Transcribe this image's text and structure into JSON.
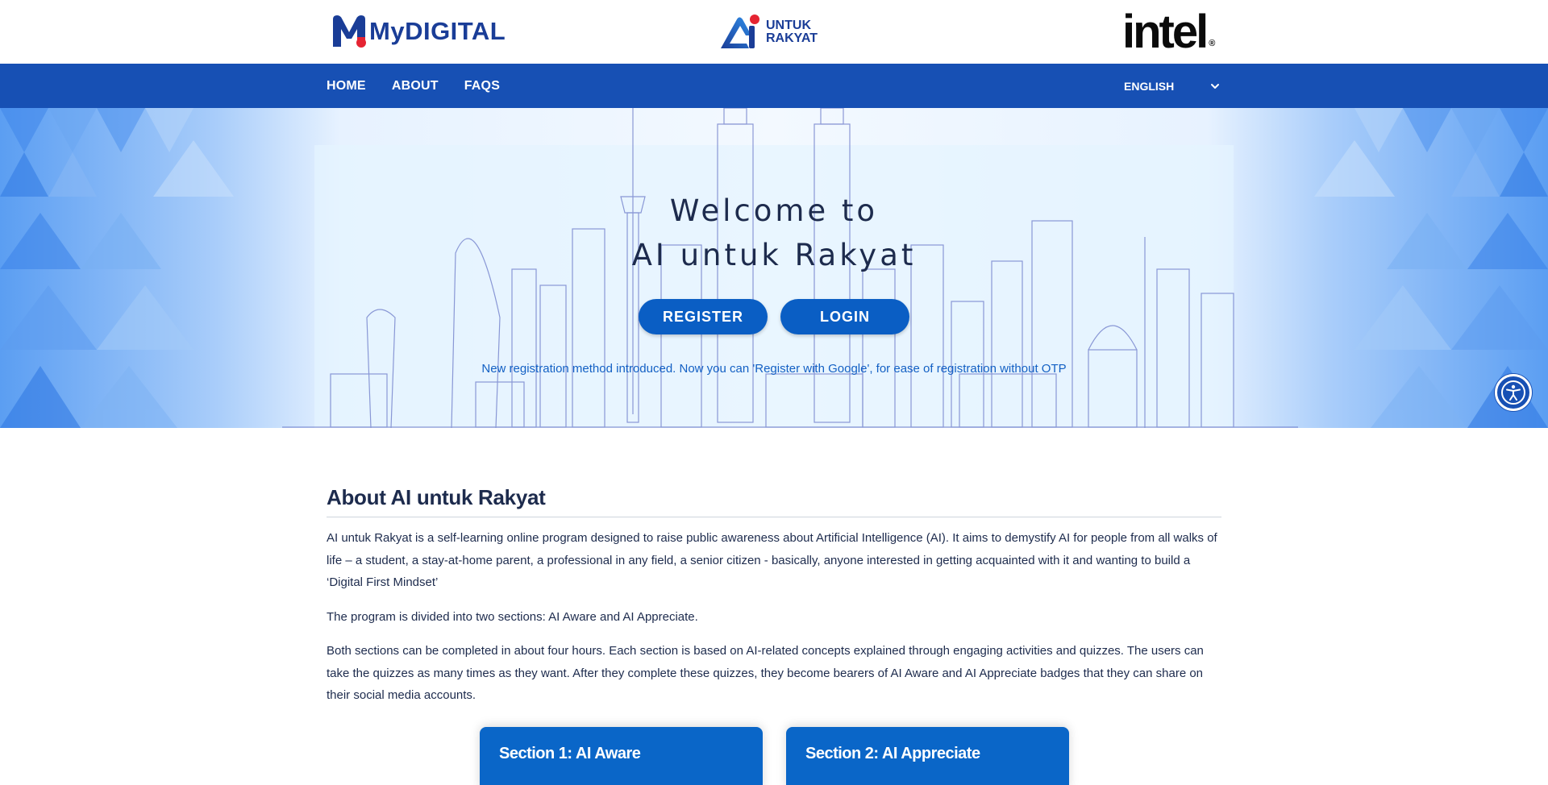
{
  "header": {
    "logos": {
      "mydigital": "MyDIGITAL",
      "untuk_rakyat_line1": "UNTUK",
      "untuk_rakyat_line2": "RAKYAT",
      "intel": "intel"
    }
  },
  "nav": {
    "items": [
      {
        "label": "HOME"
      },
      {
        "label": "ABOUT"
      },
      {
        "label": "FAQS"
      }
    ],
    "language": "ENGLISH"
  },
  "hero": {
    "title_line1": "Welcome to",
    "title_line2": "AI untuk Rakyat",
    "register_label": "REGISTER",
    "login_label": "LOGIN",
    "note": "New registration method introduced. Now you can 'Register with Google', for ease of registration without OTP"
  },
  "about": {
    "title": "About AI untuk Rakyat",
    "paragraphs": [
      "AI untuk Rakyat is a self-learning online program designed to raise public awareness about Artificial Intelligence (AI). It aims to demystify AI for people from all walks of life – a student, a stay-at-home parent, a professional in any field, a senior citizen - basically, anyone interested in getting acquainted with it and wanting to build a ‘Digital First Mindset’",
      "The program is divided into two sections: AI Aware and AI Appreciate.",
      "Both sections can be completed in about four hours. Each section is based on AI-related concepts explained through engaging activities and quizzes. The users can take the quizzes as many times as they want. After they complete these quizzes, they become bearers of AI Aware and AI Appreciate badges that they can share on their social media accounts."
    ]
  },
  "sections": [
    {
      "title": "Section 1: AI Aware"
    },
    {
      "title": "Section 2: AI Appreciate"
    }
  ],
  "colors": {
    "nav_blue": "#1750b4",
    "button_blue": "#0a5ec4",
    "card_blue": "#0a66c8",
    "note_blue": "#1360c4",
    "text_dark": "#1d2b4d"
  },
  "icons": {
    "language_dropdown": "chevron-down-icon",
    "accessibility": "accessibility-icon"
  }
}
